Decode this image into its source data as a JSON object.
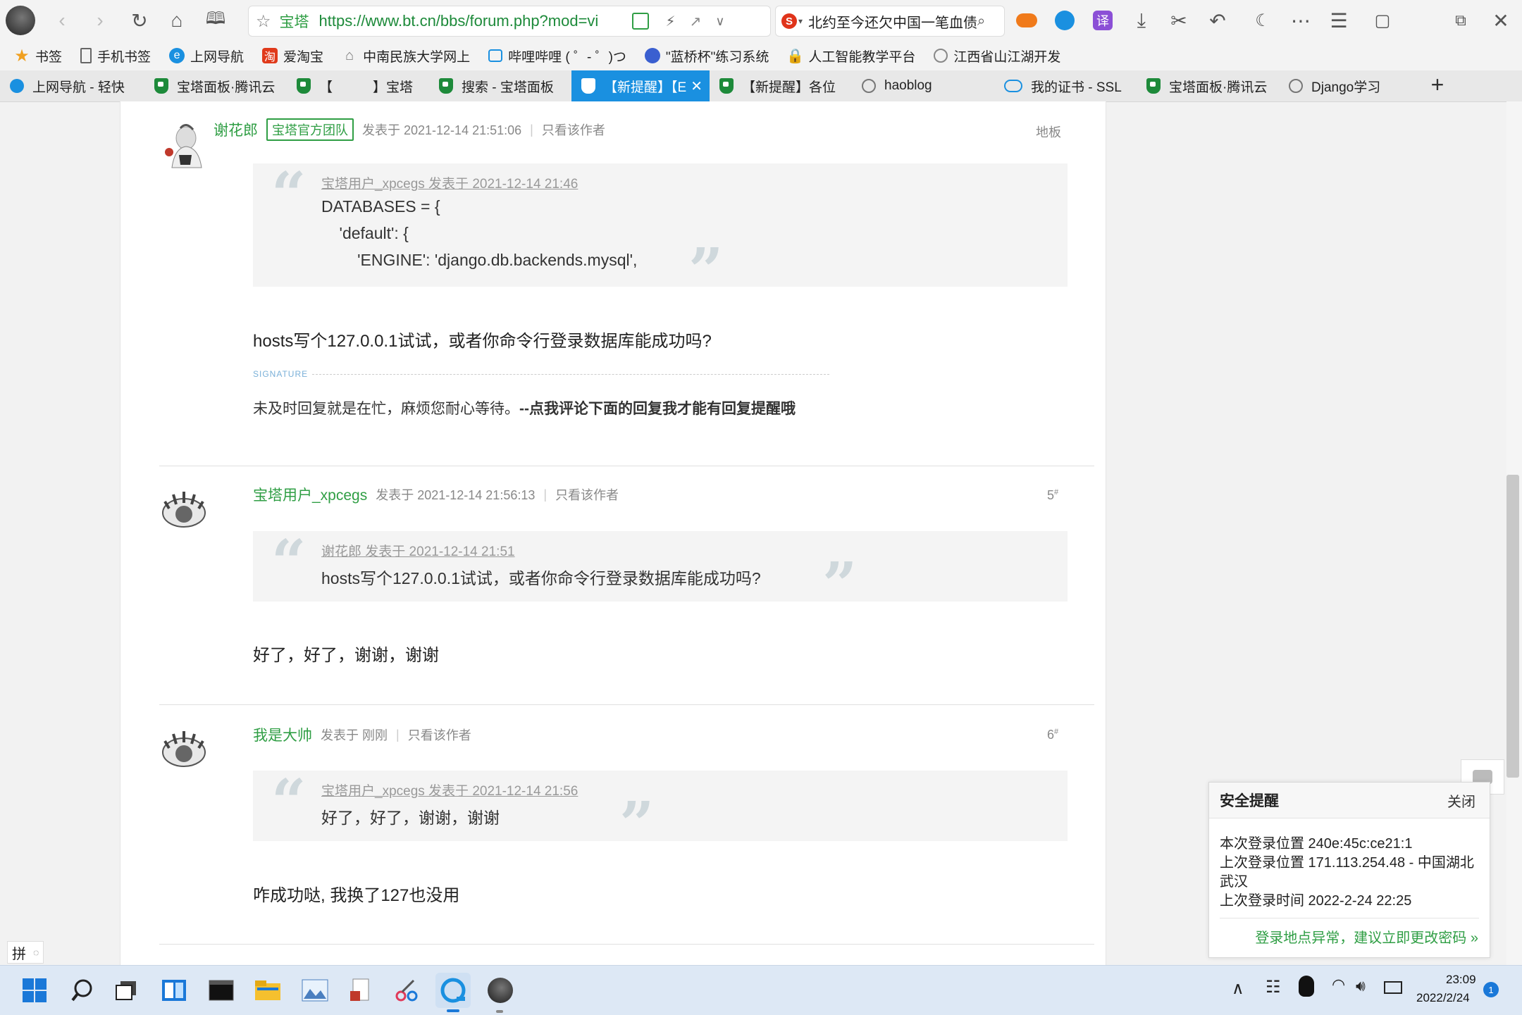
{
  "browser": {
    "site_name": "宝塔",
    "url": "https://www.bt.cn/bbs/forum.php?mod=vi",
    "search_text": "北约至今还欠中国一笔血债",
    "bookmarks": [
      "书签",
      "手机书签",
      "上网导航",
      "爱淘宝",
      "中南民族大学网上",
      "哔哩哔哩 ( ゜- ゜)つ",
      "\"蓝桥杯\"练习系统",
      "人工智能教学平台",
      "江西省山江湖开发"
    ],
    "tabs": [
      "上网导航 - 轻快",
      "宝塔面板·腾讯云",
      "【　　　】宝塔",
      "搜索 - 宝塔面板",
      "【新提醒】【E",
      "【新提醒】各位",
      "haoblog",
      "我的证书 - SSL",
      "宝塔面板·腾讯云",
      "Django学习"
    ],
    "new_tab": "+"
  },
  "posts": [
    {
      "author": "谢花郎",
      "badge": "宝塔官方团队",
      "posted": "发表于 2021-12-14 21:51:06",
      "only_author": "只看该作者",
      "floor": "地板",
      "quote_head": "宝塔用户_xpcegs 发表于 2021-12-14 21:46",
      "quote_lines": [
        "DATABASES = {",
        "    'default': {",
        "        'ENGINE': 'django.db.backends.mysql',"
      ],
      "body": "hosts写个127.0.0.1试试，或者你命令行登录数据库能成功吗?",
      "signature_label": "SIGNATURE",
      "signature_text": "未及时回复就是在忙，麻烦您耐心等待。",
      "signature_bold": "--点我评论下面的回复我才能有回复提醒哦"
    },
    {
      "author": "宝塔用户_xpcegs",
      "posted": "发表于 2021-12-14 21:56:13",
      "only_author": "只看该作者",
      "floor": "5",
      "quote_head": "谢花郎 发表于 2021-12-14 21:51",
      "quote_line": "hosts写个127.0.0.1试试，或者你命令行登录数据库能成功吗?",
      "body": "好了，好了，谢谢，谢谢"
    },
    {
      "author": "我是大帅",
      "posted": "发表于 刚刚",
      "only_author": "只看该作者",
      "floor": "6",
      "quote_head": "宝塔用户_xpcegs 发表于 2021-12-14 21:56",
      "quote_line": "好了，好了，谢谢，谢谢",
      "body": "咋成功哒, 我换了127也没用"
    }
  ],
  "security_popup": {
    "title": "安全提醒",
    "close": "关闭",
    "line1": "本次登录位置 240e:45c:ce21:1",
    "line2": "上次登录位置 171.113.254.48 - 中国湖北武汉",
    "line3": "上次登录时间 2022-2-24 22:25",
    "link": "登录地点异常，建议立即更改密码 »"
  },
  "ime": "拼",
  "taskbar": {
    "time": "23:09",
    "date": "2022/2/24",
    "notifications": "1"
  },
  "colors": {
    "accent_green": "#2f9e44",
    "active_tab": "#1a90e0"
  }
}
